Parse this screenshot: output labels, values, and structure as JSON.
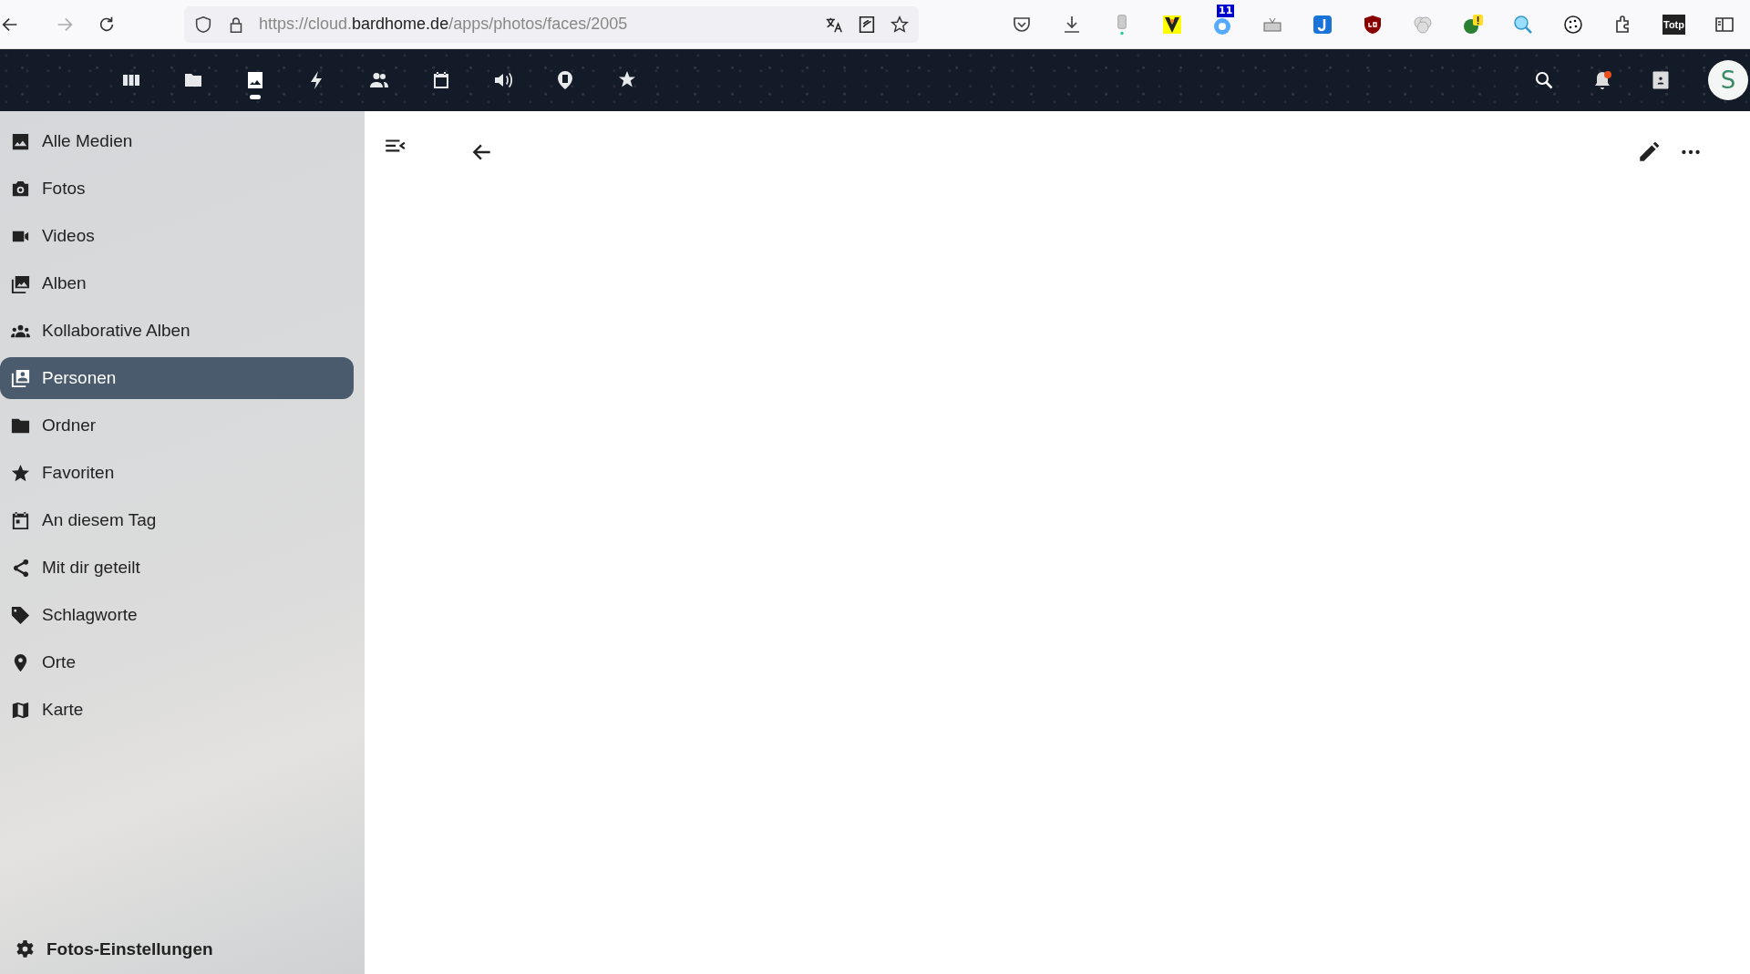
{
  "browser": {
    "url": {
      "prefix": "https://cloud.",
      "domain": "bardhome.de",
      "path": "/apps/photos/faces/2005"
    },
    "badge": "11",
    "totp": "Totp"
  },
  "header": {
    "apps": [
      {
        "selected": false
      },
      {
        "selected": false
      },
      {
        "selected": true
      },
      {
        "selected": false
      },
      {
        "selected": false
      },
      {
        "selected": false
      },
      {
        "selected": false
      },
      {
        "selected": false
      },
      {
        "selected": false
      }
    ],
    "unread_notifications": true,
    "avatar": "S"
  },
  "sidebar": {
    "items": [
      {
        "label": "Alle Medien",
        "selected": false
      },
      {
        "label": "Fotos",
        "selected": false
      },
      {
        "label": "Videos",
        "selected": false
      },
      {
        "label": "Alben",
        "selected": false
      },
      {
        "label": "Kollaborative Alben",
        "selected": false
      },
      {
        "label": "Personen",
        "selected": true
      },
      {
        "label": "Ordner",
        "selected": false
      },
      {
        "label": "Favoriten",
        "selected": false
      },
      {
        "label": "An diesem Tag",
        "selected": false
      },
      {
        "label": "Mit dir geteilt",
        "selected": false
      },
      {
        "label": "Schlagworte",
        "selected": false
      },
      {
        "label": "Orte",
        "selected": false
      },
      {
        "label": "Karte",
        "selected": false
      }
    ],
    "settings": "Fotos-Einstellungen"
  }
}
